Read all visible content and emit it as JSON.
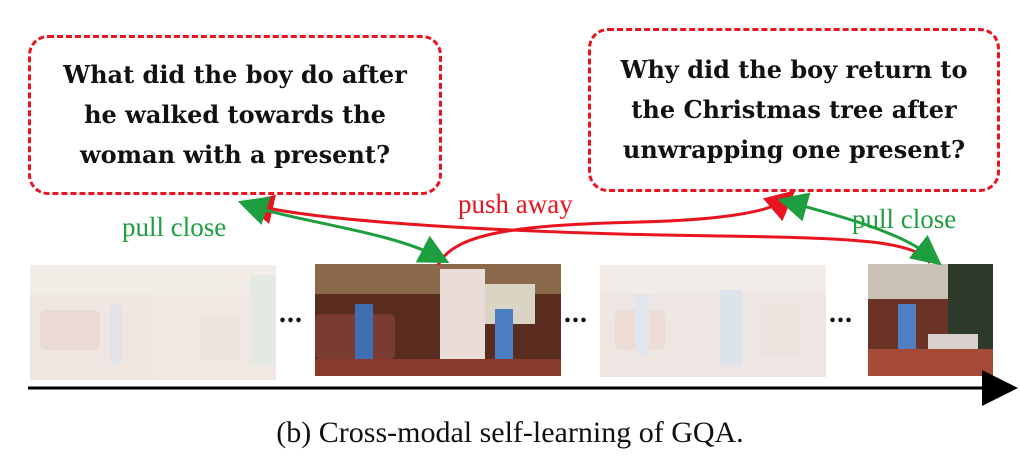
{
  "questions": {
    "left": "What did the boy do after he walked towards the woman with a present?",
    "right": "Why did the boy return to the Christmas tree after unwrapping one present?"
  },
  "labels": {
    "pull_close_left": "pull close",
    "push_away": "push away",
    "pull_close_right": "pull close"
  },
  "ellipsis": "...",
  "caption": "(b) Cross-modal self-learning of GQA.",
  "colors": {
    "dash_border": "#e8141f",
    "pull": "#1e9e3e",
    "push": "#e8141f",
    "timeline": "#000000"
  }
}
